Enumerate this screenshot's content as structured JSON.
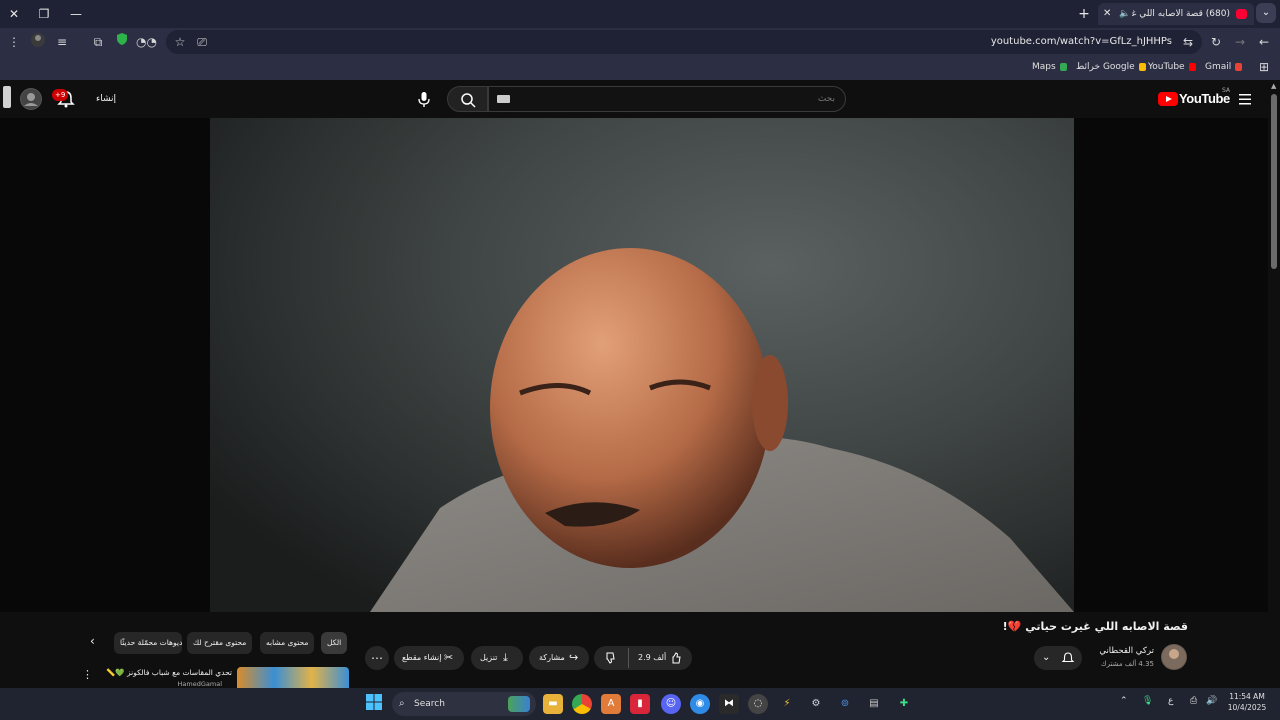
{
  "browser": {
    "tab_title": "(680) قصة الاصابه اللي غيرت",
    "tab_audio_icon": "speaker-icon",
    "url": "youtube.com/watch?v=GfLz_hJHHPs",
    "bookmarks": [
      "Gmail",
      "YouTube",
      "خرائط Google",
      "Maps"
    ]
  },
  "youtube": {
    "logo_text": "YouTube",
    "country_code": "SA",
    "search_placeholder": "بحث",
    "create_label": "إنشاء",
    "notifications_badge": "+9",
    "video": {
      "title": "قصة الاصابه اللي غيرت حياتي 💔!",
      "channel_name": "تركي القحطاني",
      "subscribers": "4.35 ألف مشترك",
      "likes": "2.9 ألف",
      "share_label": "مشاركة",
      "download_label": "تنزيل",
      "clip_label": "إنشاء مقطع"
    },
    "chips": [
      "الكل",
      "محتوى مشابه",
      "محتوى مقترح لك",
      "فيديوهات محمّلة حديثًا"
    ],
    "recommendation": {
      "title": "تحدي المقاسات مع شباب فالكونز 💚📏",
      "channel": "HamedGamal"
    }
  },
  "taskbar": {
    "search_label": "Search",
    "time": "11:54 AM",
    "date": "10/4/2025",
    "lang": "ع"
  },
  "colors": {
    "chrome_frame": "#1f2235",
    "chrome_toolbar": "#2c2f44",
    "youtube_bg": "#0f0f0f",
    "youtube_red": "#ff0000",
    "taskbar": "#202330"
  }
}
